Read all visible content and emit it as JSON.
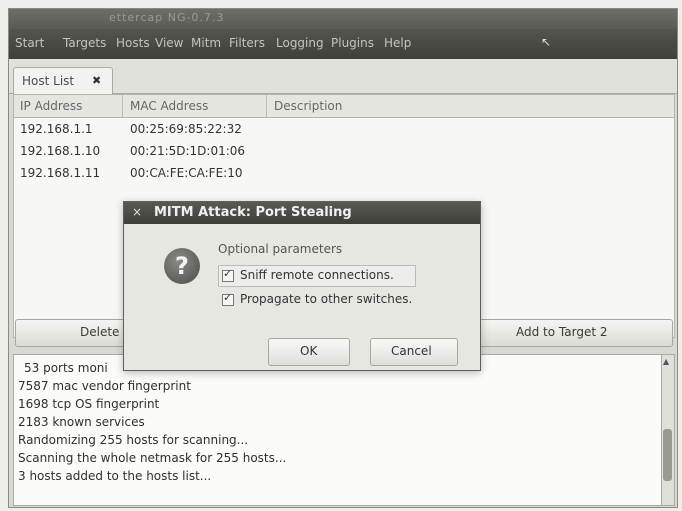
{
  "window": {
    "title": "ettercap NG-0.7.3"
  },
  "menubar": {
    "items": [
      "Start",
      "Targets",
      "Hosts",
      "View",
      "Mitm",
      "Filters",
      "Logging",
      "Plugins",
      "Help"
    ]
  },
  "tab": {
    "label": "Host List",
    "close": "✖"
  },
  "table": {
    "headers": [
      "IP Address",
      "MAC Address",
      "Description"
    ],
    "rows": [
      {
        "ip": "192.168.1.1",
        "mac": "00:25:69:85:22:32",
        "desc": ""
      },
      {
        "ip": "192.168.1.10",
        "mac": "00:21:5D:1D:01:06",
        "desc": ""
      },
      {
        "ip": "192.168.1.11",
        "mac": "00:CA:FE:CA:FE:10",
        "desc": ""
      }
    ]
  },
  "buttons": {
    "delete": "Delete",
    "add_target2": "Add to Target 2"
  },
  "log": {
    "lines": [
      "53 ports moni",
      "7587 mac vendor fingerprint",
      "1698 tcp OS fingerprint",
      "2183 known services",
      "Randomizing 255 hosts for scanning...",
      "Scanning the whole netmask for 255 hosts...",
      "3 hosts added to the hosts list..."
    ]
  },
  "dialog": {
    "close": "×",
    "title": "MITM Attack: Port Stealing",
    "icon": "question-icon",
    "icon_glyph": "?",
    "optional_title": "Optional parameters",
    "options": [
      "Sniff remote connections.",
      "Propagate to other switches."
    ],
    "ok": "OK",
    "cancel": "Cancel"
  },
  "cursor": {
    "glyph": "↖"
  }
}
